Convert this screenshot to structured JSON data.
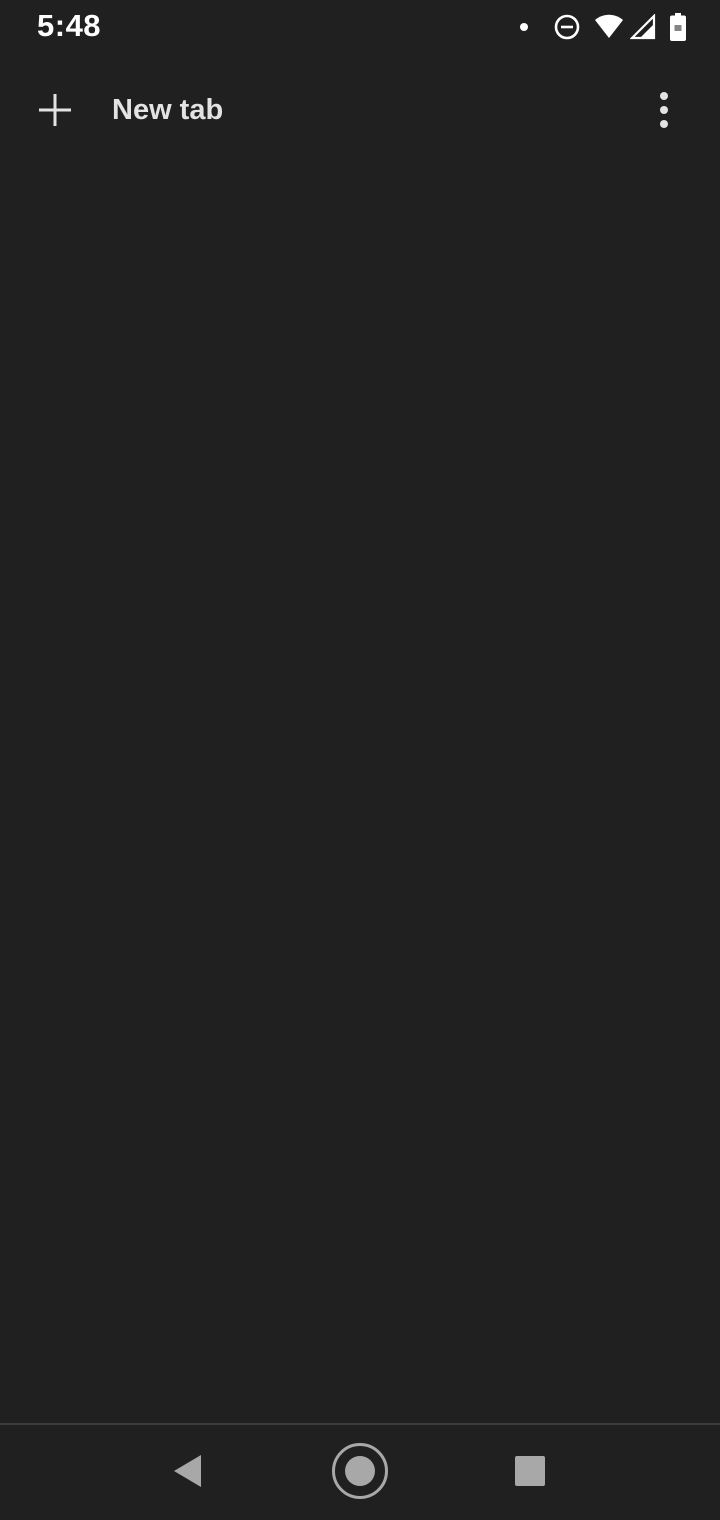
{
  "status_bar": {
    "time": "5:48",
    "icons": [
      "notification-dot-icon",
      "do-not-disturb-icon",
      "wifi-icon",
      "cell-signal-icon",
      "battery-full-icon"
    ]
  },
  "toolbar": {
    "new_tab_label": "New tab",
    "new_tab_icon": "plus-icon",
    "menu_icon": "more-vert-icon"
  },
  "nav_bar": {
    "back_icon": "back-triangle-icon",
    "home_icon": "home-circle-icon",
    "recents_icon": "recents-square-icon"
  },
  "colors": {
    "background": "#202020",
    "text_primary": "#e3e3e3",
    "nav_icon": "#a8a8a8",
    "divider": "#3c3c3c"
  }
}
